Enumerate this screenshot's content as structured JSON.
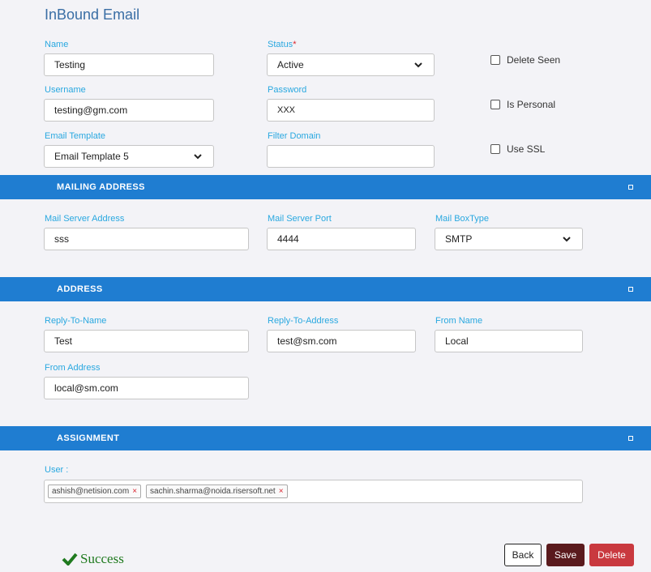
{
  "page": {
    "title": "InBound Email"
  },
  "general": {
    "name": {
      "label": "Name",
      "value": "Testing"
    },
    "status": {
      "label": "Status",
      "required_mark": "*",
      "value": "Active"
    },
    "username": {
      "label": "Username",
      "value": "testing@gm.com"
    },
    "password": {
      "label": "Password",
      "value": "XXX"
    },
    "email_template": {
      "label": "Email Template",
      "value": "Email Template 5"
    },
    "filter_domain": {
      "label": "Filter Domain",
      "value": ""
    },
    "checkboxes": {
      "delete_seen": {
        "label": "Delete Seen",
        "checked": false
      },
      "is_personal": {
        "label": "Is Personal",
        "checked": false
      },
      "use_ssl": {
        "label": "Use SSL",
        "checked": false
      }
    }
  },
  "mailing": {
    "title": "MAILING ADDRESS",
    "server_address": {
      "label": "Mail Server Address",
      "value": "sss"
    },
    "server_port": {
      "label": "Mail Server Port",
      "value": "4444"
    },
    "box_type": {
      "label": "Mail BoxType",
      "value": "SMTP"
    }
  },
  "address": {
    "title": "ADDRESS",
    "reply_to_name": {
      "label": "Reply-To-Name",
      "value": "Test"
    },
    "reply_to_address": {
      "label": "Reply-To-Address",
      "value": "test@sm.com"
    },
    "from_name": {
      "label": "From Name",
      "value": "Local"
    },
    "from_address": {
      "label": "From Address",
      "value": "local@sm.com"
    }
  },
  "assignment": {
    "title": "ASSIGNMENT",
    "user_label": "User :",
    "users": [
      {
        "email": "ashish@netision.com",
        "remove": "×"
      },
      {
        "email": "sachin.sharma@noida.risersoft.net",
        "remove": "×"
      }
    ]
  },
  "footer": {
    "success_text": "Success",
    "back_label": "Back",
    "save_label": "Save",
    "delete_label": "Delete"
  },
  "colors": {
    "section_bar": "#1f7dd1",
    "label": "#29a8e0",
    "save": "#5a1a1d",
    "delete": "#c9393f",
    "success": "#1f7a1f"
  }
}
